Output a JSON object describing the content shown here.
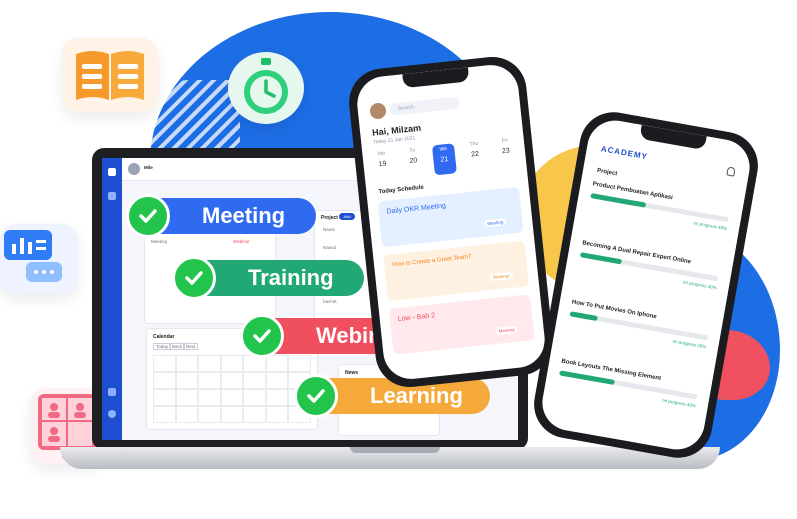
{
  "pills": [
    {
      "label": "Meeting",
      "color": "#2f6af0"
    },
    {
      "label": "Training",
      "color": "#21a874"
    },
    {
      "label": "Webinar",
      "color": "#ef4f5f"
    },
    {
      "label": "Learning",
      "color": "#f5a93a"
    }
  ],
  "laptop": {
    "user_name": "Mile",
    "panels": {
      "project_title": "Project",
      "add_label": "Add",
      "calendar_title": "Calendar",
      "news_title": "News",
      "meeting_label": "Meeting",
      "webinar_label": "Webinar",
      "project_rows": [
        "Name",
        "Nasrul",
        "Lonely",
        "Toshi",
        "hachiK."
      ]
    },
    "calendar_buttons": [
      "Today",
      "Back",
      "Next"
    ]
  },
  "phone1": {
    "greeting": "Hai, Milzam",
    "date_line": "Today 21 Jan 2021",
    "search_placeholder": "Search...",
    "weekdays": [
      "Mo",
      "Tu",
      "We",
      "Thu",
      "Fri",
      "Sa"
    ],
    "days": [
      "19",
      "20",
      "21",
      "22",
      "23"
    ],
    "selected_day": "21",
    "schedule_title": "Today Schedule",
    "cards": [
      {
        "title": "Daily OKR Meeting",
        "badge": "Meeting",
        "bg": "#e4efff",
        "fg": "#2f6af0"
      },
      {
        "title": "How to Create a Great Team?",
        "badge": "Webinar",
        "bg": "#fff1e2",
        "fg": "#f08a24"
      },
      {
        "title": "Low - Bab 2",
        "badge": "Meeting",
        "bg": "#ffe9ec",
        "fg": "#ef4f5f"
      }
    ]
  },
  "phone2": {
    "brand": "ACADEMY",
    "section_title": "Project",
    "projects": [
      {
        "title": "Product Pembuatan Aplikasi",
        "status": "on progress 40%",
        "progress": 0.4
      },
      {
        "title": "Becoming A Dual Repair Expert Online",
        "status": "on progress 30%",
        "progress": 0.3
      },
      {
        "title": "How To Put Movies On Iphone",
        "status": "on progress 20%",
        "progress": 0.2
      },
      {
        "title": "Book Layouts The Missing Element",
        "status": "on progress 40%",
        "progress": 0.4
      }
    ]
  },
  "decor": {
    "icons": [
      "book-icon",
      "stopwatch-icon",
      "chat-chart-icon",
      "video-call-icon"
    ]
  }
}
